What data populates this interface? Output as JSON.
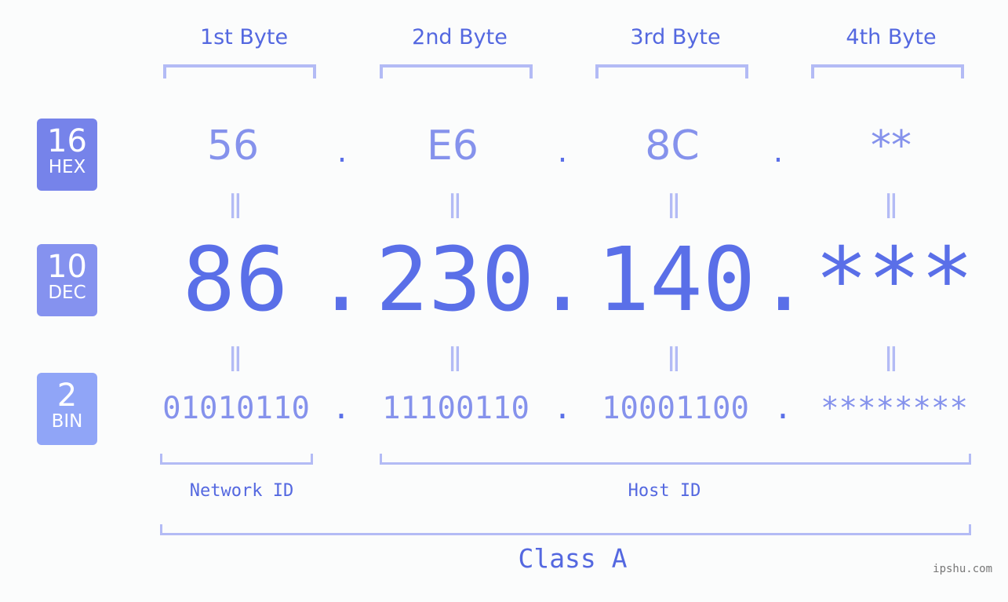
{
  "bytes": [
    {
      "header": "1st Byte",
      "hex": "56",
      "dec": "86",
      "bin": "01010110"
    },
    {
      "header": "2nd Byte",
      "hex": "E6",
      "dec": "230",
      "bin": "11100110"
    },
    {
      "header": "3rd Byte",
      "hex": "8C",
      "dec": "140",
      "bin": "10001100"
    },
    {
      "header": "4th Byte",
      "hex": "**",
      "dec": "***",
      "bin": "********"
    }
  ],
  "separator": ".",
  "equals": "=",
  "badges": {
    "hex": {
      "number": "16",
      "label": "HEX",
      "color": "#7683ea"
    },
    "dec": {
      "number": "10",
      "label": "DEC",
      "color": "#8592ef"
    },
    "bin": {
      "number": "2",
      "label": "BIN",
      "color": "#90a5f7"
    }
  },
  "segments": {
    "network": "Network ID",
    "host": "Host ID",
    "class": "Class A"
  },
  "watermark": "ipshu.com",
  "colors": {
    "primary": "#5a6fe8",
    "secondary": "#8592ec",
    "bracket": "#b3bbf5"
  }
}
